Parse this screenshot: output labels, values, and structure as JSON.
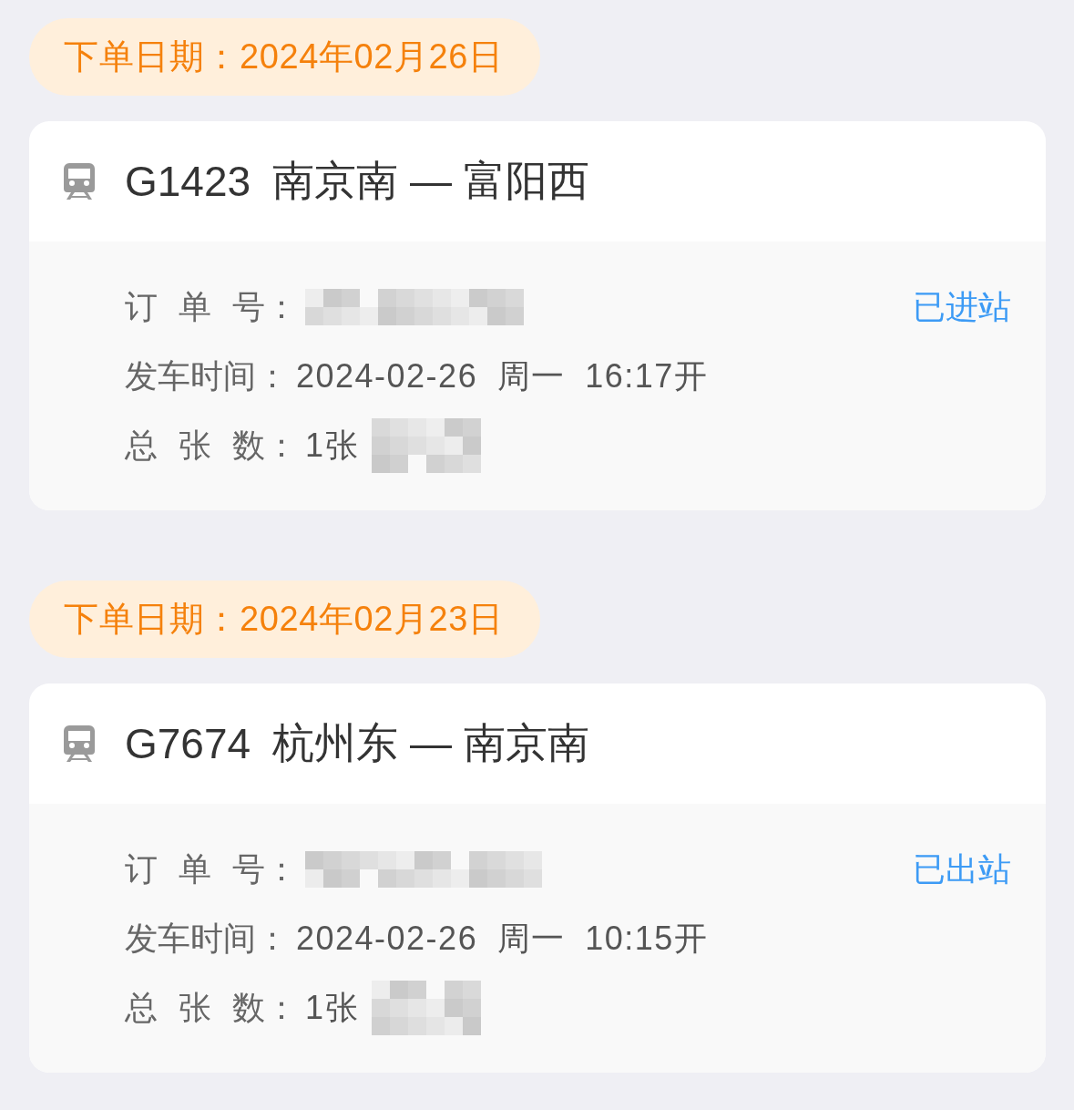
{
  "orders": [
    {
      "order_date": "下单日期：2024年02月26日",
      "train_number": "G1423",
      "route": "南京南 — 富阳西",
      "status": "已进站",
      "fields": [
        {
          "label": "订 单 号：",
          "redacted": true
        },
        {
          "label": "发车时间：",
          "value": "2024-02-26 周一 16:17开",
          "redacted": false
        },
        {
          "label": "总 张 数：",
          "value": "1张",
          "redacted": true
        }
      ]
    },
    {
      "order_date": "下单日期：2024年02月23日",
      "train_number": "G7674",
      "route": "杭州东 — 南京南",
      "status": "已出站",
      "fields": [
        {
          "label": "订 单 号：",
          "redacted": true
        },
        {
          "label": "发车时间：",
          "value": "2024-02-26 周一 10:15开",
          "redacted": false
        },
        {
          "label": "总 张 数：",
          "value": "1张",
          "redacted": true
        }
      ]
    }
  ]
}
